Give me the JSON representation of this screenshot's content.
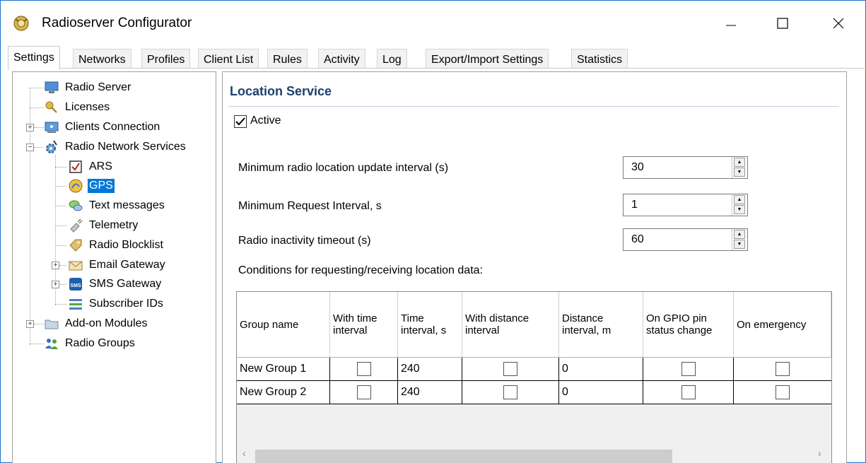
{
  "window": {
    "title": "Radioserver Configurator",
    "app_icon": "radioserver-icon"
  },
  "tabs": [
    {
      "label": "Settings",
      "active": true
    },
    {
      "label": "Networks"
    },
    {
      "label": "Profiles"
    },
    {
      "label": "Client List"
    },
    {
      "label": "Rules"
    },
    {
      "label": "Activity"
    },
    {
      "label": "Log"
    },
    {
      "label": "Export/Import Settings"
    },
    {
      "label": "Statistics"
    }
  ],
  "tree": [
    {
      "label": "Radio Server",
      "icon": "server-icon"
    },
    {
      "label": "Licenses",
      "icon": "license-key-icon"
    },
    {
      "label": "Clients Connection",
      "icon": "network-icon",
      "expandable": true
    },
    {
      "label": "Radio Network Services",
      "icon": "services-gear-icon",
      "expanded": true
    },
    {
      "label": "ARS",
      "icon": "ars-checkbox-icon"
    },
    {
      "label": "GPS",
      "icon": "gps-globe-icon",
      "selected": true
    },
    {
      "label": "Text messages",
      "icon": "chat-icon"
    },
    {
      "label": "Telemetry",
      "icon": "telemetry-plug-icon"
    },
    {
      "label": "Radio Blocklist",
      "icon": "tag-icon"
    },
    {
      "label": "Email Gateway",
      "icon": "envelope-icon",
      "expandable": true
    },
    {
      "label": "SMS Gateway",
      "icon": "sms-icon",
      "expandable": true
    },
    {
      "label": "Subscriber IDs",
      "icon": "id-list-icon"
    },
    {
      "label": "Add-on Modules",
      "icon": "folder-icon",
      "expandable": true
    },
    {
      "label": "Radio Groups",
      "icon": "people-icon"
    }
  ],
  "location_service": {
    "title": "Location Service",
    "active_label": "Active",
    "active_checked": true,
    "fields": [
      {
        "label": "Minimum radio location update interval (s)",
        "value": "30"
      },
      {
        "label": "Minimum Request Interval, s",
        "value": "1"
      },
      {
        "label": "Radio inactivity timeout (s)",
        "value": "60"
      }
    ],
    "conditions_label": "Conditions for requesting/receiving location data:",
    "columns": [
      "Group name",
      "With time interval",
      "Time interval, s",
      "With distance interval",
      "Distance interval, m",
      "On GPIO pin status change",
      "On emergency"
    ],
    "rows": [
      {
        "group": "New Group 1",
        "time_interval": "240",
        "distance_interval": "0"
      },
      {
        "group": "New Group 2",
        "time_interval": "240",
        "distance_interval": "0"
      }
    ]
  }
}
